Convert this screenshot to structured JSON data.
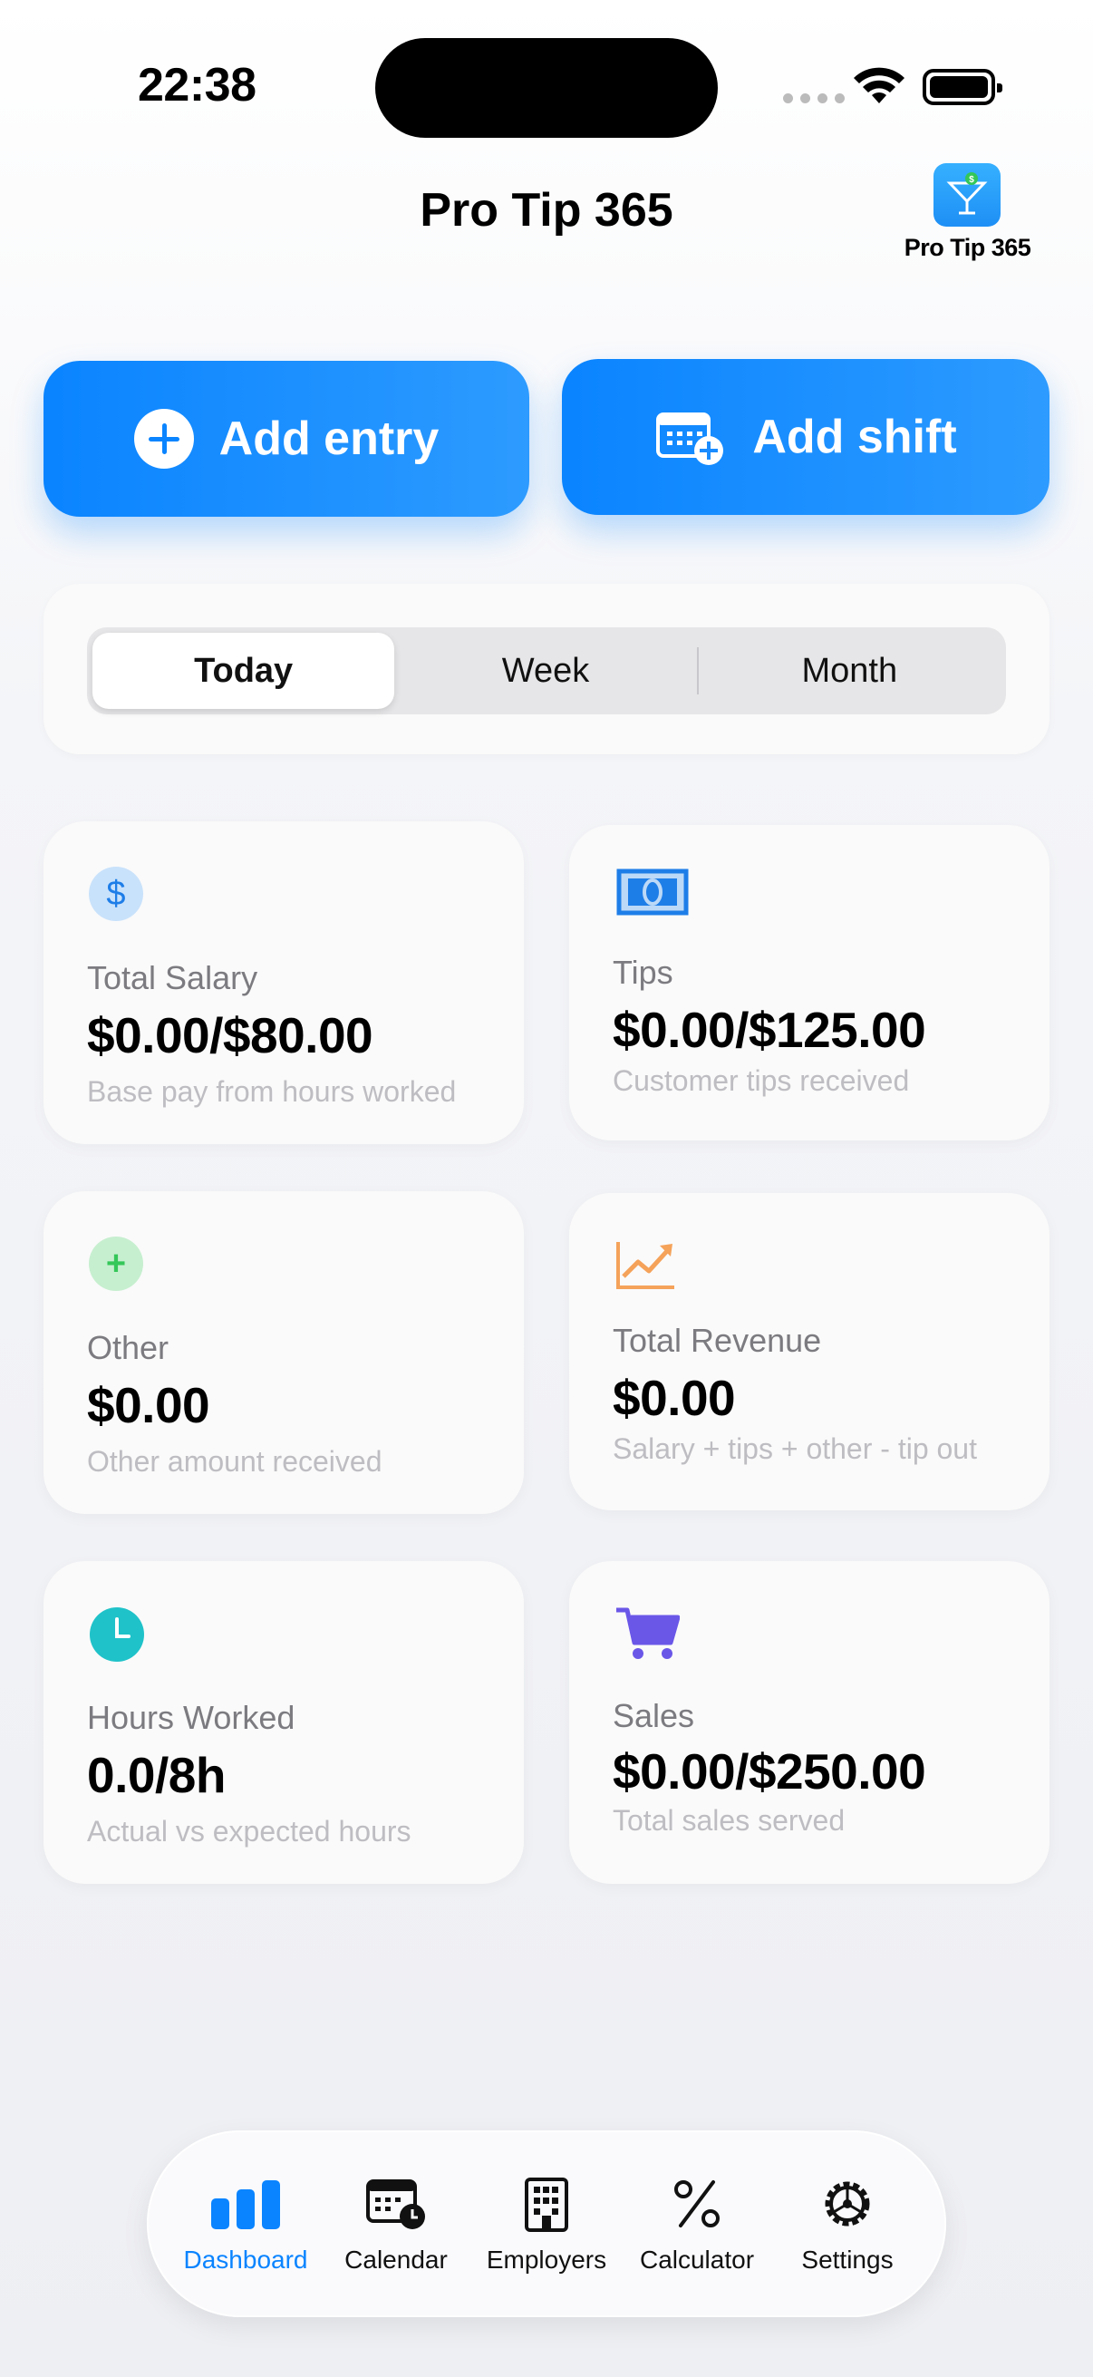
{
  "status": {
    "time": "22:38"
  },
  "header": {
    "title": "Pro Tip 365",
    "logo_label": "Pro Tip 365",
    "logo_icon": "cocktail-glass-dollar-icon"
  },
  "actions": {
    "add_entry": {
      "label": "Add entry",
      "icon": "plus-circle-icon"
    },
    "add_shift": {
      "label": "Add shift",
      "icon": "calendar-plus-icon"
    }
  },
  "period": {
    "options": [
      "Today",
      "Week",
      "Month"
    ],
    "selected": "Today"
  },
  "cards": [
    {
      "label": "Total Salary",
      "value": "$0.00/$80.00",
      "desc": "Base pay from hours worked",
      "icon": "dollar-icon",
      "color": "#1e7ee8"
    },
    {
      "label": "Tips",
      "value": "$0.00/$125.00",
      "desc": "Customer tips received",
      "icon": "banknote-icon",
      "color": "#1e7ee8"
    },
    {
      "label": "Other",
      "value": "$0.00",
      "desc": "Other amount received",
      "icon": "plus-icon",
      "color": "#34c759"
    },
    {
      "label": "Total Revenue",
      "value": "$0.00",
      "desc": "Salary + tips + other - tip out",
      "icon": "chart-up-icon",
      "color": "#f5a25a"
    },
    {
      "label": "Hours Worked",
      "value": "0.0/8h",
      "desc": "Actual vs expected hours",
      "icon": "clock-icon",
      "color": "#1fc2c9"
    },
    {
      "label": "Sales",
      "value": "$0.00/$250.00",
      "desc": "Total sales served",
      "icon": "cart-icon",
      "color": "#6a57e8"
    }
  ],
  "tabs": [
    {
      "label": "Dashboard",
      "icon": "bar-chart-icon",
      "active": true
    },
    {
      "label": "Calendar",
      "icon": "calendar-clock-icon",
      "active": false
    },
    {
      "label": "Employers",
      "icon": "building-icon",
      "active": false
    },
    {
      "label": "Calculator",
      "icon": "percent-icon",
      "active": false
    },
    {
      "label": "Settings",
      "icon": "gear-icon",
      "active": false
    }
  ],
  "colors": {
    "accent": "#0a84ff",
    "background": "#f2f3f7"
  }
}
